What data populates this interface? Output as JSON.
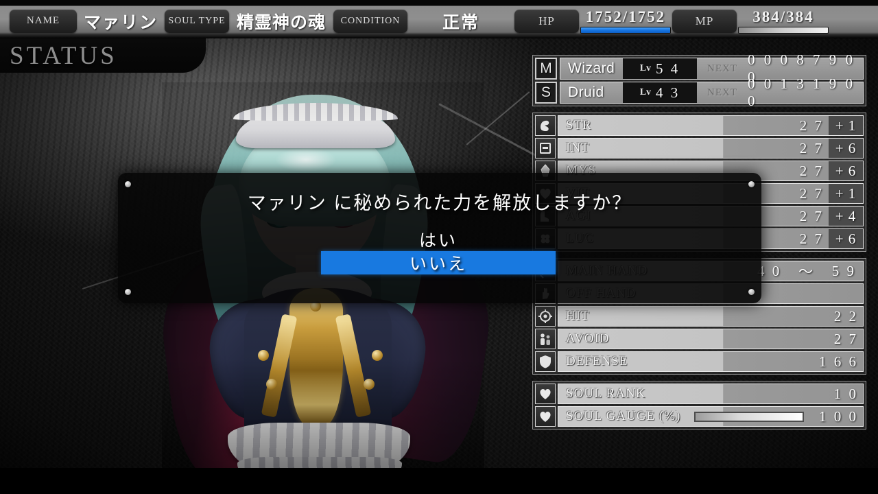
{
  "header": {
    "name_label": "NAME",
    "name_value": "マァリン",
    "soul_type_label": "SOUL TYPE",
    "soul_type_value": "精霊神の魂",
    "condition_label": "CONDITION",
    "condition_value": "正常",
    "hp_label": "HP",
    "hp_value": "1752/1752",
    "hp_percent": 100,
    "mp_label": "MP",
    "mp_value": "384/384",
    "mp_percent": 100,
    "hp_color": "#1878e6",
    "mp_color": "#f2f2f2"
  },
  "page_title": "STATUS",
  "classes": [
    {
      "badge": "M",
      "name": "Wizard",
      "lv_label": "Lv",
      "level": "5 4",
      "next_label": "NEXT",
      "next_value": "0 0 0 8 7 9 0 0"
    },
    {
      "badge": "S",
      "name": "Druid",
      "lv_label": "Lv",
      "level": "4 3",
      "next_label": "NEXT",
      "next_value": "0 0 1 3 1 9 0 0"
    }
  ],
  "attributes": [
    {
      "icon": "arm-icon",
      "label": "STR",
      "value": "2 7",
      "bonus": "+ 1"
    },
    {
      "icon": "book-icon",
      "label": "INT",
      "value": "2 7",
      "bonus": "+ 6"
    },
    {
      "icon": "crystal-icon",
      "label": "MYS",
      "value": "2 7",
      "bonus": "+ 6"
    },
    {
      "icon": "heart-icon",
      "label": "VIT",
      "value": "2 7",
      "bonus": "+ 1"
    },
    {
      "icon": "boot-icon",
      "label": "AGI",
      "value": "2 7",
      "bonus": "+ 4"
    },
    {
      "icon": "clover-icon",
      "label": "LUC",
      "value": "2 7",
      "bonus": "+ 6"
    }
  ],
  "combat": [
    {
      "icon": "sword-icon",
      "label": "MAIN HAND",
      "min": "4 0",
      "sep": "～",
      "max": "5 9"
    },
    {
      "icon": "offhand-icon",
      "label": "OFF  HAND",
      "value": ""
    },
    {
      "icon": "target-icon",
      "label": "HIT",
      "value": "2 2"
    },
    {
      "icon": "dodge-icon",
      "label": "AVOID",
      "value": "2 7"
    },
    {
      "icon": "shield-icon",
      "label": "DEFENSE",
      "value": "1 6 6"
    }
  ],
  "soul": {
    "rank": {
      "icon": "heart-icon",
      "label": "SOUL RANK",
      "value": "1 0"
    },
    "gauge": {
      "icon": "heart-icon",
      "label": "SOUL GAUGE (%)",
      "value": "1 0 0",
      "percent": 100
    }
  },
  "dialog": {
    "question": "マァリン に秘められた力を解放しますか？",
    "yes_label": "はい",
    "no_label": "いいえ",
    "selected": "no",
    "highlight_color": "#1879e0"
  }
}
